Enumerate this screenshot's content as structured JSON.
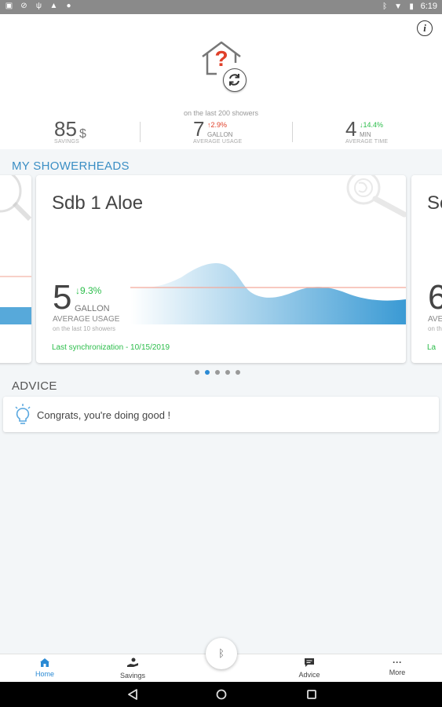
{
  "statusbar": {
    "time": "6:19",
    "left_icons": [
      "sim-icon",
      "block-icon",
      "usb-icon",
      "warning-icon",
      "location-icon"
    ],
    "right_icons": [
      "bluetooth-icon",
      "wifi-icon",
      "battery-icon"
    ]
  },
  "header": {
    "info_icon": "info-icon",
    "house_icon": "house-question-icon",
    "sync_icon": "sync-icon",
    "caption": "on the last 200 showers",
    "stats": [
      {
        "value": "85",
        "unit": "$",
        "label": "SAVINGS"
      },
      {
        "value": "7",
        "delta": "↑2.9%",
        "delta_dir": "up",
        "unit": "GALLON",
        "label": "AVERAGE USAGE"
      },
      {
        "value": "4",
        "delta": "↓14.4%",
        "delta_dir": "down",
        "unit": "MIN",
        "label": "AVERAGE TIME"
      }
    ]
  },
  "showerheads": {
    "title": "MY SHOWERHEADS",
    "card": {
      "name": "Sdb 1 Aloe",
      "value": "5",
      "delta": "↓9.3%",
      "unit": "GALLON",
      "label": "AVERAGE USAGE",
      "sublabel": "on the last 10 showers",
      "sync": "Last synchronization - 10/15/2019"
    },
    "right_card": {
      "name_fragment": "Sc",
      "value_fragment": "6",
      "unit_fragment": "AVE",
      "sub_fragment": "on th",
      "sync_fragment": "La"
    },
    "pager": {
      "count": 5,
      "active": 1
    }
  },
  "advice": {
    "title": "ADVICE",
    "icon": "lightbulb-icon",
    "text": "Congrats, you're doing good !"
  },
  "tabbar": {
    "tabs": [
      {
        "label": "Home",
        "icon": "home-icon",
        "active": true
      },
      {
        "label": "Savings",
        "icon": "savings-icon",
        "active": false
      },
      {
        "label": "Advice",
        "icon": "chat-icon",
        "active": false
      },
      {
        "label": "More",
        "icon": "more-icon",
        "active": false
      }
    ],
    "fab_icon": "bluetooth-icon"
  },
  "navbar": {
    "icons": [
      "back-icon",
      "home-circle-icon",
      "recents-icon"
    ]
  },
  "colors": {
    "accent": "#2a8ad4",
    "positive": "#2bbd4a",
    "negative": "#e0402a",
    "section_title": "#3a8ec4"
  }
}
